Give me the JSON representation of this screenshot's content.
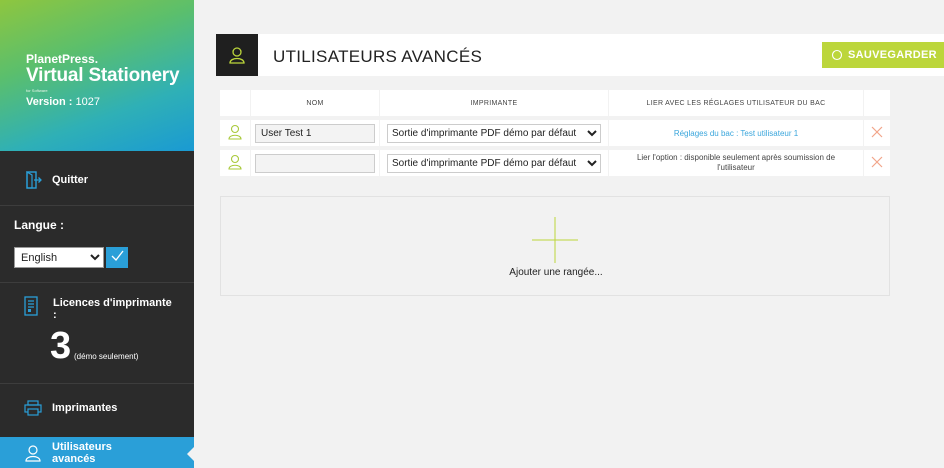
{
  "sidebar": {
    "brand_top": "PlanetPress.",
    "brand_main": "Virtual Stationery",
    "brand_tiny": "for Software",
    "version_label": "Version :",
    "version_value": "1027",
    "quit_label": "Quitter",
    "language_title": "Langue :",
    "language_selected": "English",
    "licenses_label": "Licences d'imprimante :",
    "licenses_count": "3",
    "licenses_note": "(démo seulement)",
    "printers_label": "Imprimantes",
    "advanced_users_label": "Utilisateurs avancés"
  },
  "header": {
    "title": "UTILISATEURS AVANCÉS",
    "save_label": "SAUVEGARDER"
  },
  "table": {
    "columns": [
      "NOM",
      "IMPRIMANTE",
      "LIER AVEC LES RÉGLAGES UTILISATEUR DU BAC"
    ],
    "rows": [
      {
        "name": "User Test 1",
        "printer": "Sortie d'imprimante PDF démo par défaut",
        "link": "Réglages du bac : Test utilisateur 1"
      },
      {
        "name": "",
        "printer": "Sortie d'imprimante PDF démo par défaut",
        "link": "Lier l'option : disponible seulement après soumission de l'utilisateur"
      }
    ],
    "add_row_label": "Ajouter une rangée..."
  },
  "colors": {
    "accent_blue": "#2a9fd8",
    "save_green": "#bcd63b",
    "user_icon": "#a8c93a",
    "delete_icon": "#f2a58a"
  }
}
